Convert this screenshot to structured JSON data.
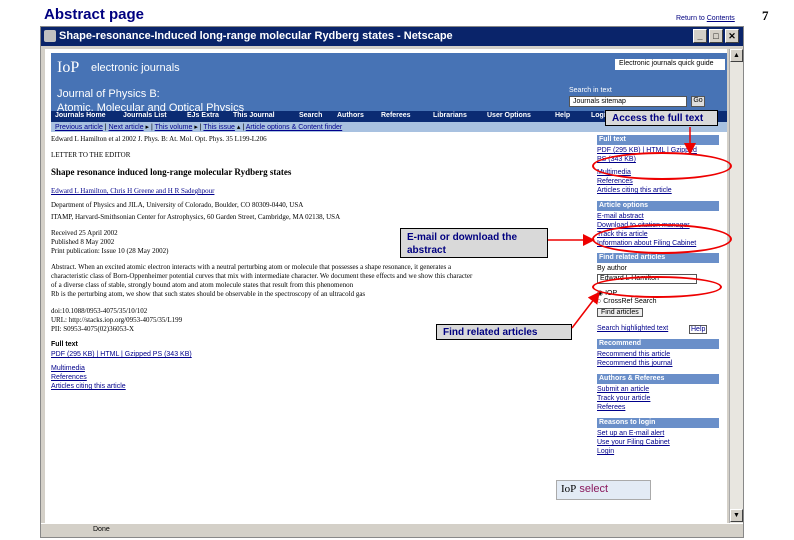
{
  "slide": {
    "title": "Abstract page",
    "return_link_prefix": "Return to",
    "return_link": "Contents",
    "page_number": "7"
  },
  "browser": {
    "window_title": "Shape-resonance-Induced long-range molecular Rydberg states - Netscape",
    "status_text": "Done"
  },
  "header": {
    "logo": "IoP",
    "brand": "electronic journals",
    "journal_line1": "Journal of Physics B:",
    "journal_line2": "Atomic, Molecular and Optical Physics",
    "quick_guide": "Electronic journals quick guide",
    "search_label": "Search in text",
    "search_select": "Journals sitemap",
    "search_go": "Go"
  },
  "nav": {
    "items": [
      "Journals Home",
      "Journals List",
      "EJs Extra",
      "This Journal",
      "Search",
      "Authors",
      "Referees",
      "Librarians",
      "User Options",
      "Help"
    ],
    "login": "Login"
  },
  "subnav": {
    "items": [
      "Previous article",
      "Next article",
      "This volume",
      "This issue",
      "Article options & Content finder"
    ]
  },
  "article": {
    "citation": "Edward L Hamilton et al 2002 J. Phys. B: At. Mol. Opt. Phys. 35 L199-L206",
    "type": "LETTER TO THE EDITOR",
    "title": "Shape resonance induced long-range molecular Rydberg states",
    "authors": "Edward L Hamilton, Chris H Greene and H R Sadeghpour",
    "affil1": "Department of Physics and JILA, University of Colorado, Boulder, CO 80309-0440, USA",
    "affil2": "ITAMP, Harvard-Smithsonian Center for Astrophysics, 60 Garden Street, Cambridge, MA 02138, USA",
    "received": "Received 25 April 2002",
    "published": "Published 8 May 2002",
    "print_pub": "Print publication: Issue 10 (28 May 2002)",
    "abs1": "Abstract. When an excited atomic electron interacts with a neutral perturbing atom or molecule that possesses a shape resonance, it generates a",
    "abs2": "characteristic class of Born-Oppenheimer potential curves that mix with intermediate character. We document these effects and we show this character",
    "abs3": "of a diverse class of stable, strongly bound atom and atom molecule states that result from this phenomenon",
    "abs4": "Rb is the perturbing atom, we show that such states should be observable in the spectroscopy of an ultracold gas",
    "doi": "doi:10.1088/0953-4075/35/10/102",
    "url": "URL: http://stacks.iop.org/0953-4075/35/L199",
    "pii": "PII: S0953-4075(02)36053-X",
    "fulltext_heading": "Full text",
    "fulltext_links": "PDF (295 KB) | HTML | Gzipped PS (343 KB)",
    "multimedia": "Multimedia",
    "references": "References",
    "citing": "Articles citing this article"
  },
  "sidebar": {
    "fulltext_heading": "Full text",
    "fulltext_links": "PDF (295 KB) | HTML | Gzipped",
    "fulltext_ps": "PS (343 KB)",
    "multimedia": "Multimedia",
    "references": "References",
    "citing": "Articles citing this article",
    "options_heading": "Article options",
    "email_abstract": "E-mail abstract",
    "download_citation": "Download to citation manager",
    "track_article": "Track this article",
    "filing_cabinet": "Information about Filing Cabinet",
    "related_heading": "Find related articles",
    "by_author": "By author",
    "author_select": "Edward L Hamilton",
    "radio_iop": "IOP",
    "radio_crossref": "CrossRef Search",
    "find_button": "Find articles",
    "search_highlighted": "Search highlighted text",
    "help": "Help",
    "recommend_heading": "Recommend",
    "recommend_article": "Recommend this article",
    "recommend_journal": "Recommend this journal",
    "authors_heading": "Authors & Referees",
    "submit_article": "Submit an article",
    "track_your": "Track your article",
    "referees": "Referees",
    "reasons_heading": "Reasons to login",
    "email_alert": "Set up an E-mail alert",
    "filing": "Use your Filing Cabinet",
    "login": "Login"
  },
  "badge": {
    "logo": "IoP",
    "text": "select"
  },
  "callouts": {
    "full_text": "Access the full text",
    "email": "E-mail or download the abstract",
    "related": "Find related articles"
  },
  "colors": {
    "title_navy": "#000080",
    "oval_red": "#e00000",
    "header_blue": "#4773b5",
    "nav_dark": "#0b2b73"
  }
}
